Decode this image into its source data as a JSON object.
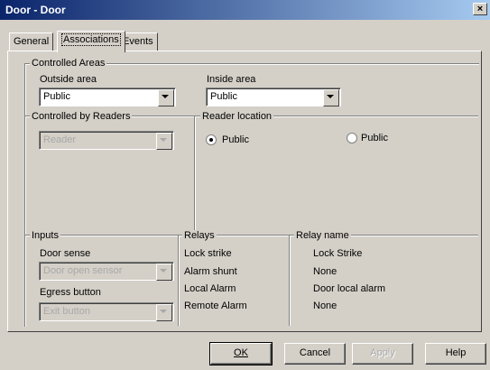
{
  "window": {
    "title": "Door - Door",
    "close_glyph": "×"
  },
  "tabs": [
    {
      "label": "General"
    },
    {
      "label": "Associations"
    },
    {
      "label": "Events"
    }
  ],
  "controlled_areas": {
    "title": "Controlled Areas",
    "outside_label": "Outside area",
    "outside_value": "Public",
    "inside_label": "Inside area",
    "inside_value": "Public"
  },
  "readers": {
    "title": "Controlled by Readers",
    "value": "Reader"
  },
  "reader_location": {
    "title": "Reader location",
    "options": [
      {
        "label": "Public",
        "checked": true
      },
      {
        "label": "Public",
        "checked": false
      }
    ]
  },
  "inputs": {
    "title": "Inputs",
    "door_sense_label": "Door sense",
    "door_sense_value": "Door open sensor",
    "egress_label": "Egress button",
    "egress_value": "Exit button"
  },
  "relays": {
    "title": "Relays",
    "items": [
      "Lock strike",
      "Alarm shunt",
      "Local Alarm",
      "Remote Alarm"
    ]
  },
  "relay_name": {
    "title": "Relay name",
    "items": [
      "Lock Strike",
      "None",
      "Door local alarm",
      "None"
    ]
  },
  "buttons": {
    "ok": "OK",
    "cancel": "Cancel",
    "apply": "Apply",
    "help": "Help"
  },
  "icons": {
    "dropdown": "chevron-down-icon",
    "close": "close-icon"
  }
}
